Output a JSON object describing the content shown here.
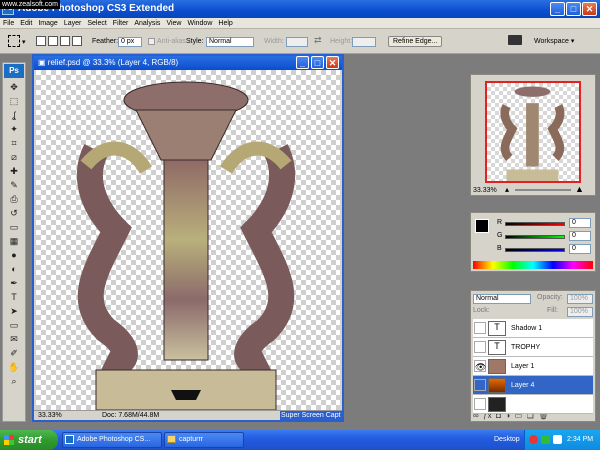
{
  "window": {
    "title": "Adobe Photoshop CS3 Extended",
    "app_icon": "Ps",
    "minimize": "_",
    "maximize": "□",
    "close": "✕"
  },
  "watermark": "www.zealsoft.com",
  "menu": [
    "File",
    "Edit",
    "Image",
    "Layer",
    "Select",
    "Filter",
    "Analysis",
    "View",
    "Window",
    "Help"
  ],
  "options": {
    "feather_label": "Feather:",
    "feather_value": "0 px",
    "antialias_label": "Anti-alias",
    "style_label": "Style:",
    "style_value": "Normal",
    "width_label": "Width:",
    "height_label": "Height:",
    "refine_edge": "Refine Edge...",
    "workspace": "Workspace ▾"
  },
  "tools": {
    "logo": "Ps",
    "icons": [
      "move-icon",
      "marquee-icon",
      "lasso-icon",
      "magic-wand-icon",
      "crop-icon",
      "slice-icon",
      "healing-icon",
      "brush-icon",
      "stamp-icon",
      "history-brush-icon",
      "eraser-icon",
      "gradient-icon",
      "blur-icon",
      "dodge-icon",
      "pen-icon",
      "type-icon",
      "path-select-icon",
      "shape-icon",
      "notes-icon",
      "eyedropper-icon",
      "hand-icon",
      "zoom-icon"
    ],
    "glyphs": [
      "✥",
      "⬚",
      "ʆ",
      "✦",
      "⌗",
      "⧄",
      "✚",
      "✎",
      "⎙",
      "↺",
      "▭",
      "▦",
      "●",
      "◐",
      "✒",
      "T",
      "➤",
      "▭",
      "✉",
      "✐",
      "✋",
      "⌕"
    ]
  },
  "document": {
    "title": "relief.psd @ 33.3% (Layer 4, RGB/8)",
    "zoom": "33.33%",
    "doc_info": "Doc: 7.68M/44.8M",
    "caption": "Super Screen Capt"
  },
  "navigator": {
    "zoom": "33.33%"
  },
  "color": {
    "r_label": "R",
    "g_label": "G",
    "b_label": "B",
    "r_value": "0",
    "g_value": "0",
    "b_value": "0"
  },
  "layers": {
    "blend_mode": "Normal",
    "opacity_label": "Opacity:",
    "opacity_value": "100%",
    "lock_label": "Lock:",
    "fill_label": "Fill:",
    "fill_value": "100%",
    "rows": [
      {
        "name": "Shadow 1",
        "visible": false,
        "thumb": "T"
      },
      {
        "name": "TROPHY",
        "visible": false,
        "thumb": "T"
      },
      {
        "name": "Layer 1",
        "visible": true,
        "thumb": ""
      },
      {
        "name": "Layer 4",
        "visible": false,
        "thumb": ""
      },
      {
        "name": "",
        "visible": false,
        "thumb": ""
      }
    ]
  },
  "taskbar": {
    "start": "start",
    "tasks": [
      "Adobe Photoshop CS...",
      "capturrr"
    ],
    "desktop": "Desktop",
    "clock": "2:34 PM"
  }
}
